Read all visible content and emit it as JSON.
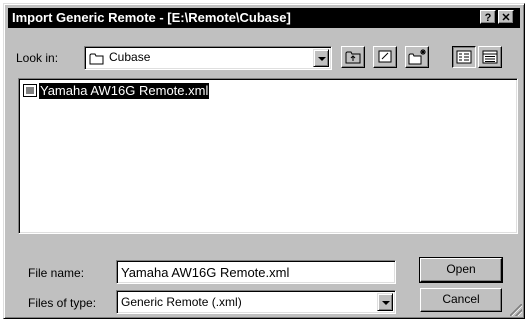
{
  "window": {
    "title": "Import Generic Remote - [E:\\Remote\\Cubase]",
    "help_glyph": "?",
    "close_glyph": "✕"
  },
  "look_in": {
    "label": "Look in:",
    "value": "Cubase",
    "icon": "folder-icon"
  },
  "toolbar": {
    "buttons": [
      {
        "name": "up-one-level",
        "icon": "folder-up-icon"
      },
      {
        "name": "desktop",
        "icon": "desktop-icon"
      },
      {
        "name": "new-folder",
        "icon": "new-folder-icon"
      },
      {
        "name": "list-view",
        "icon": "list-view-icon",
        "pressed": true
      },
      {
        "name": "details-view",
        "icon": "details-view-icon"
      }
    ]
  },
  "files": [
    {
      "name": "Yamaha AW16G Remote.xml",
      "selected": true,
      "icon": "document-icon"
    }
  ],
  "file_name": {
    "label": "File name:",
    "value": "Yamaha AW16G Remote.xml"
  },
  "file_type": {
    "label": "Files of type:",
    "value": "Generic Remote (.xml)"
  },
  "buttons": {
    "open": "Open",
    "cancel": "Cancel"
  },
  "colors": {
    "titlebar": "#000000",
    "face": "#c0c0c0",
    "selection": "#000000"
  }
}
